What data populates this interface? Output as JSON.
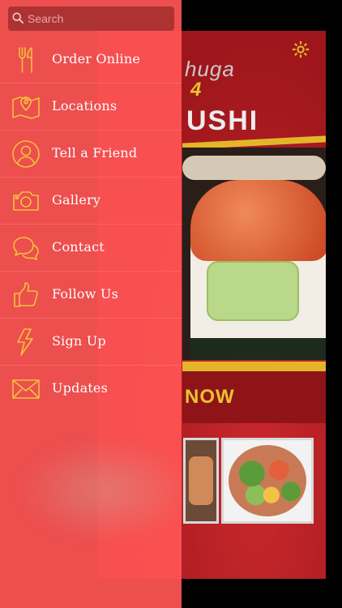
{
  "search": {
    "placeholder": "Search"
  },
  "menu": {
    "items": [
      {
        "label": "Order Online",
        "icon": "fork-knife-icon"
      },
      {
        "label": "Locations",
        "icon": "map-pin-icon"
      },
      {
        "label": "Tell a Friend",
        "icon": "person-icon"
      },
      {
        "label": "Gallery",
        "icon": "camera-icon"
      },
      {
        "label": "Contact",
        "icon": "chat-bubbles-icon"
      },
      {
        "label": "Follow Us",
        "icon": "thumbs-up-icon"
      },
      {
        "label": "Sign Up",
        "icon": "lightning-icon"
      },
      {
        "label": "Updates",
        "icon": "envelope-icon"
      }
    ]
  },
  "app": {
    "brand_top": "huga",
    "brand_mid": "4",
    "brand_bottom": "USHI",
    "order_cta": "NOW",
    "settings_icon": "gear-icon"
  },
  "colors": {
    "drawer": "#ff5454",
    "icon_gold": "#f2c23c",
    "app_red": "#b41c22",
    "accent_yellow": "#e8c431"
  }
}
